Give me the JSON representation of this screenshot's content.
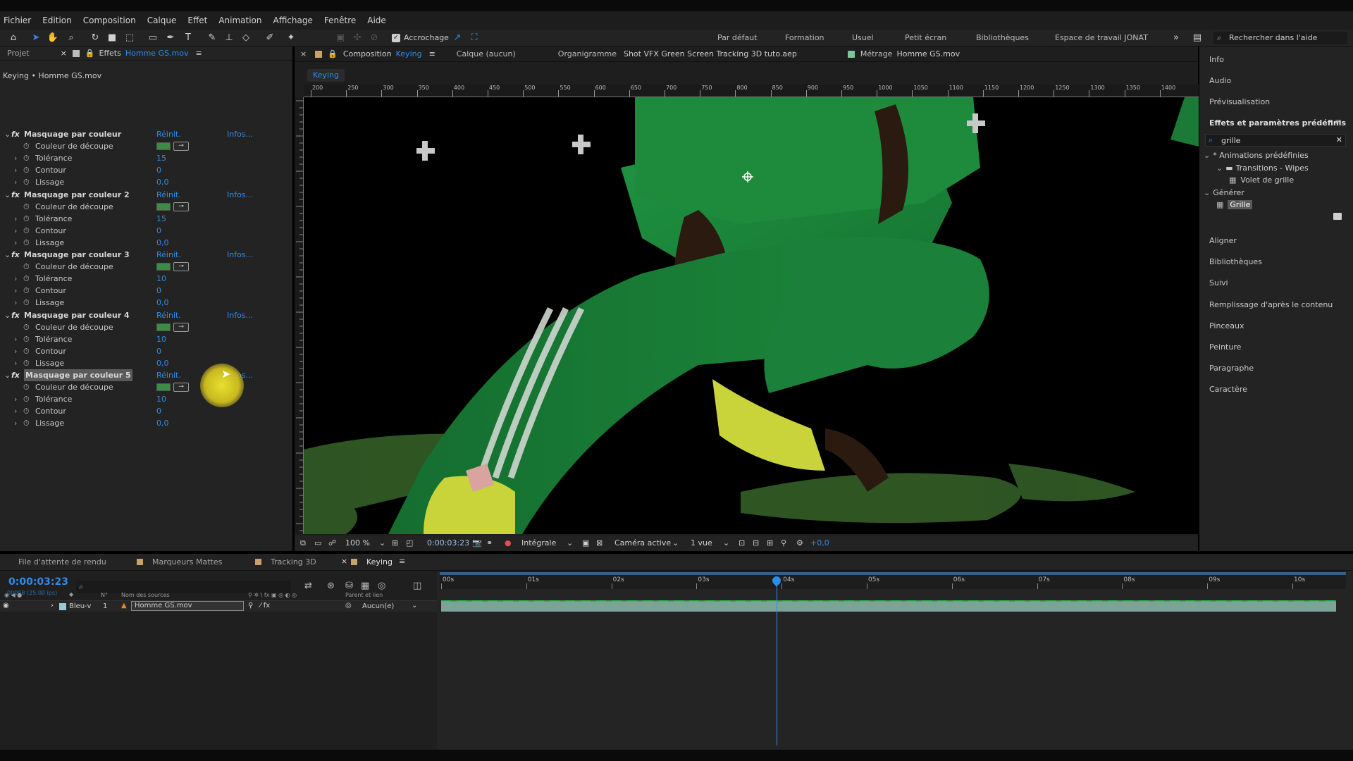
{
  "menu": [
    "Fichier",
    "Edition",
    "Composition",
    "Calque",
    "Effet",
    "Animation",
    "Affichage",
    "Fenêtre",
    "Aide"
  ],
  "toolbar": {
    "snap_label": "Accrochage",
    "workspaces": [
      "Par défaut",
      "Formation",
      "Usuel",
      "Petit écran",
      "Bibliothèques",
      "Espace de travail JONAT"
    ],
    "search_placeholder": "Rechercher dans l'aide"
  },
  "left_panel": {
    "tabs": {
      "project": "Projet",
      "close": "×",
      "effects": "Effets",
      "file": "Homme GS.mov"
    },
    "subtitle": "Keying • Homme GS.mov",
    "reset": "Réinit.",
    "infos": "Infos...",
    "labels": {
      "color": "Couleur de découpe",
      "tolerance": "Tolérance",
      "contour": "Contour",
      "smooth": "Lissage"
    },
    "effects": [
      {
        "name": "Masquage par couleur",
        "tolerance": "15",
        "contour": "0",
        "smooth": "0,0"
      },
      {
        "name": "Masquage par couleur 2",
        "tolerance": "15",
        "contour": "0",
        "smooth": "0,0"
      },
      {
        "name": "Masquage par couleur 3",
        "tolerance": "10",
        "contour": "0",
        "smooth": "0,0"
      },
      {
        "name": "Masquage par couleur 4",
        "tolerance": "10",
        "contour": "0",
        "smooth": "0,0"
      },
      {
        "name": "Masquage par couleur 5",
        "tolerance": "10",
        "contour": "0",
        "smooth": "0,0"
      }
    ]
  },
  "viewer": {
    "tabs": {
      "comp_prefix": "Composition",
      "comp_name": "Keying",
      "layer": "Calque (aucun)",
      "flow_prefix": "Organigramme",
      "flow_name": "Shot VFX Green Screen Tracking 3D tuto.aep",
      "footage_prefix": "Métrage",
      "footage_name": "Homme GS.mov"
    },
    "comp_chip": "Keying",
    "ruler_labels": [
      "200",
      "250",
      "300",
      "350",
      "400",
      "450",
      "500",
      "550",
      "600",
      "650",
      "700",
      "750",
      "800",
      "850",
      "900",
      "950",
      "1000",
      "1050",
      "1100",
      "1150",
      "1200",
      "1250",
      "1300",
      "1350",
      "1400"
    ],
    "footer": {
      "zoom": "100 %",
      "timecode": "0:00:03:23",
      "resolution": "Intégrale",
      "camera": "Caméra active",
      "views": "1 vue",
      "exposure": "+0,0"
    }
  },
  "right_panel": {
    "top_items": [
      "Info",
      "Audio",
      "Prévisualisation"
    ],
    "effects_title": "Effets et paramètres prédéfinis",
    "search_value": "grille",
    "tree": [
      {
        "label": "* Animations prédéfinies",
        "indent": 0
      },
      {
        "label": "Transitions - Wipes",
        "indent": 1
      },
      {
        "label": "Volet de grille",
        "indent": 2
      },
      {
        "label": "Générer",
        "indent": 0
      },
      {
        "label": "Grille",
        "indent": 1
      }
    ],
    "bottom_items": [
      "Aligner",
      "Bibliothèques",
      "Suivi",
      "Remplissage d'après le contenu",
      "Pinceaux",
      "Peinture",
      "Paragraphe",
      "Caractère"
    ]
  },
  "timeline": {
    "tabs": [
      "File d'attente de rendu",
      "Marqueurs Mattes",
      "Tracking 3D",
      "Keying"
    ],
    "timecode": "0:00:03:23",
    "frames": "00098 (25.00 ips)",
    "cols": {
      "num": "N°",
      "source": "Nom des sources",
      "parent": "Parent et lien"
    },
    "layer": {
      "label": "Bleu-v",
      "num": "1",
      "name": "Homme GS.mov",
      "parent": "Aucun(e)"
    },
    "time_marks": [
      "00s",
      "01s",
      "02s",
      "03s",
      "04s",
      "05s",
      "06s",
      "07s",
      "08s",
      "09s",
      "10s"
    ],
    "playhead_fraction": 0.37
  },
  "colors": {
    "accent": "#2d8ceb",
    "key_green": "#3d8b45",
    "shirt_green": "#1e8a3c",
    "shoe_yellow": "#c8d43a"
  }
}
